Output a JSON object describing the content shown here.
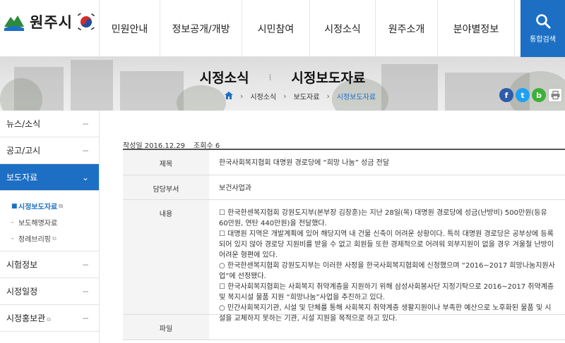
{
  "header": {
    "logo_text": "원주시",
    "nav": [
      "민원안내",
      "정보공개/개방",
      "시민참여",
      "시정소식",
      "원주소개",
      "분야별정보"
    ],
    "search_label": "통합검색"
  },
  "page": {
    "section": "시정소식",
    "title": "시정보도자료"
  },
  "breadcrumb": [
    "시정소식",
    "보도자료",
    "시정보도자료"
  ],
  "share_icons": [
    "facebook-icon",
    "twitter-icon",
    "blog-icon",
    "print-icon"
  ],
  "colors": {
    "primary": "#1d6fc4",
    "facebook": "#2e5ca8",
    "twitter": "#1da1f2",
    "blog": "#3eaf3a"
  },
  "sidebar": {
    "items": [
      {
        "label": "뉴스/소식",
        "toggle": "−"
      },
      {
        "label": "공고/고시",
        "toggle": "−"
      },
      {
        "label": "보도자료",
        "toggle": "⌄"
      },
      {
        "label": "시험정보",
        "toggle": "−"
      },
      {
        "label": "시정일정",
        "toggle": "−"
      },
      {
        "label": "시정홍보관",
        "toggle": "−"
      }
    ],
    "subitems": [
      "시정보도자료",
      "보도해명자료",
      "정례브리핑"
    ]
  },
  "article": {
    "date_label": "작성일 2016.12.29",
    "views_label": "조회수 6",
    "rows": {
      "title_label": "제목",
      "title_value": "한국사회복지협회 대명원 경로당에 “희망 나눔” 성금 전달",
      "dept_label": "담당부서",
      "dept_value": "보건사업과",
      "content_label": "내용",
      "content_lines": [
        "☐ 한국한센복지협회 강원도지부(본부장 김창훈)는 지난 28일(목) 대명원 경로당에 성금(난방비) 500만원(등유 60만원, 연탄 440만원)을 전달했다.",
        "☐ 대명원 지역은 개발계획에 있어 해당지역 내 건물 신축이 어려운 상황이다. 특히 대명원 경로당은 공부상에 등록되어 있지 않아 경로당 지원비를 받을 수 없고 회원들 또한 경제적으로 어려워 외부지원이 없을 경우 겨울철 난방이 어려운 형편에 있다.",
        "○ 한국한센복지협회 강원도지부는 이러한 사정을 한국사회복지협회에 신청했으며 “2016~2017 희망나눔지원사업”에 선정됐다.",
        "☐ 한국사회복지협회는 사회복지 취약계층을 지원하기 위해 삼성사회봉사단 지정기탁으로 2016~2017 취약계층 및 복지시설 물품 지원 “희망나눔”사업을 추진하고 있다.",
        "○ 민간사회복지기관, 시설 및 단체를 통해 사회복지 취약계층 생활지원이나 부족한 예산으로 노후화된 물품 및 시설을 교체하지 못하는 기관, 시설 지원을 목적으로 하고 있다."
      ],
      "file_label": "파일"
    }
  }
}
